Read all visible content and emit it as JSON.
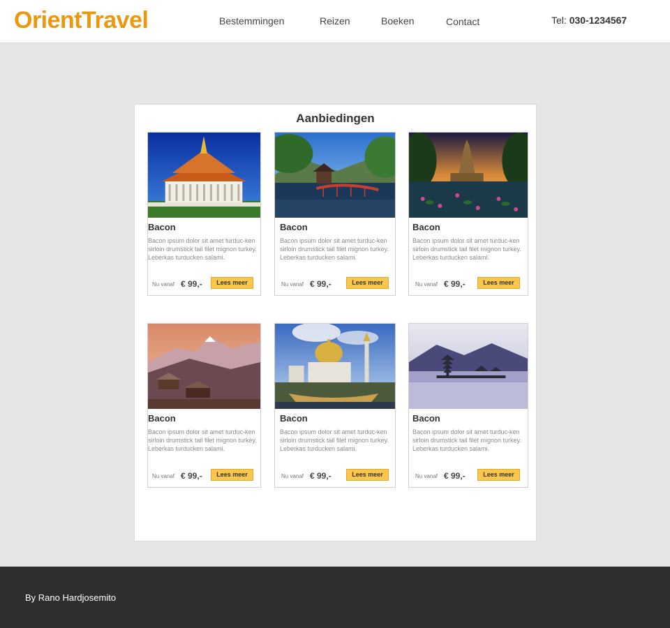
{
  "header": {
    "logo": "OrientTravel",
    "nav": [
      "Bestemmingen",
      "Reizen",
      "Boeken",
      "Contact"
    ],
    "phone_label": "Tel:",
    "phone_number": "030-1234567"
  },
  "panel": {
    "title": "Aanbiedingen"
  },
  "cards": [
    {
      "title": "Bacon",
      "text": "Bacon ipsum dolor sit amet turduc-ken sirloin drumstick tail filet mignon turkey. Leberkas turducken salami.",
      "price_label": "Nu vanaf",
      "price": "€ 99,-",
      "button": "Lees meer",
      "image": "temple-icon"
    },
    {
      "title": "Bacon",
      "text": "Bacon ipsum dolor sit amet turduc-ken sirloin drumstick tail filet mignon turkey. Leberkas turducken salami.",
      "price_label": "Nu vanaf",
      "price": "€ 99,-",
      "button": "Lees meer",
      "image": "bridge-lake-icon"
    },
    {
      "title": "Bacon",
      "text": "Bacon ipsum dolor sit amet turduc-ken sirloin drumstick tail filet mignon turkey. Leberkas turducken salami.",
      "price_label": "Nu vanaf",
      "price": "€ 99,-",
      "button": "Lees meer",
      "image": "stupa-lotus-icon"
    },
    {
      "title": "Bacon",
      "text": "Bacon ipsum dolor sit amet turduc-ken sirloin drumstick tail filet mignon turkey. Leberkas turducken salami.",
      "price_label": "Nu vanaf",
      "price": "€ 99,-",
      "button": "Lees meer",
      "image": "mountain-village-icon"
    },
    {
      "title": "Bacon",
      "text": "Bacon ipsum dolor sit amet turduc-ken sirloin drumstick tail filet mignon turkey. Leberkas turducken salami.",
      "price_label": "Nu vanaf",
      "price": "€ 99,-",
      "button": "Lees meer",
      "image": "mosque-icon"
    },
    {
      "title": "Bacon",
      "text": "Bacon ipsum dolor sit amet turduc-ken sirloin drumstick tail filet mignon turkey. Leberkas turducken salami.",
      "price_label": "Nu vanaf",
      "price": "€ 99,-",
      "button": "Lees meer",
      "image": "lake-pagoda-icon"
    }
  ],
  "footer": {
    "text": "By Rano Hardjosemito"
  },
  "colors": {
    "brand": "#e9980f",
    "button": "#fbc64a",
    "footer": "#2e2e2e",
    "background": "#e6e6e6"
  }
}
